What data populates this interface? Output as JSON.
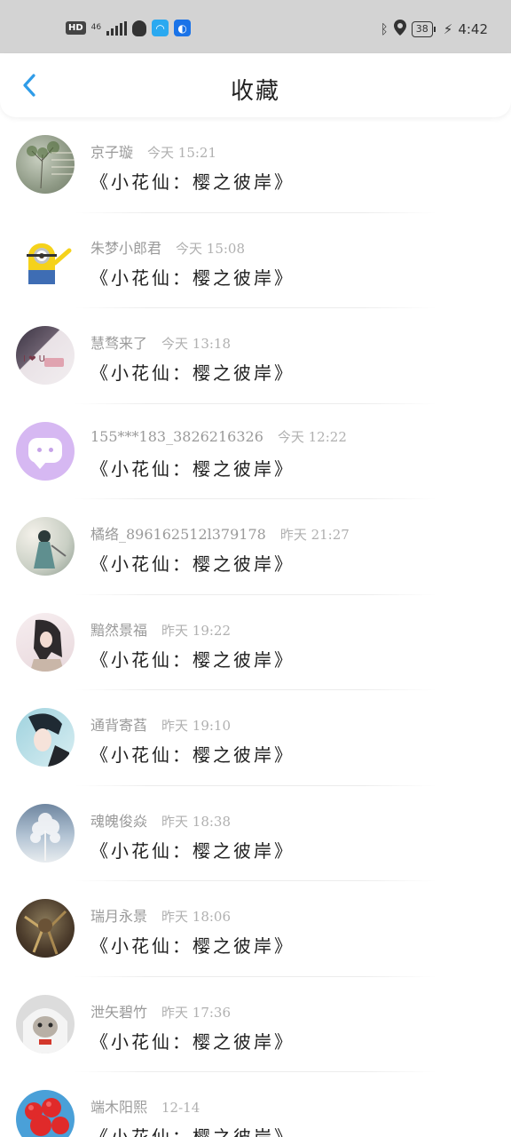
{
  "status_bar": {
    "hd": "HD",
    "network": "46",
    "battery": "38",
    "time": "4:42"
  },
  "header": {
    "title": "收藏"
  },
  "colors": {
    "accent": "#2f9ce8",
    "username": "#9a9a9a",
    "title_text": "#1f1f1f"
  },
  "favorites": [
    {
      "user": "京子璇",
      "time": "今天 15:21",
      "title": "《小花仙：樱之彼岸》",
      "avatar": "a1"
    },
    {
      "user": "朱梦小郎君",
      "time": "今天 15:08",
      "title": "《小花仙：樱之彼岸》",
      "avatar": "a2"
    },
    {
      "user": "慧骛来了",
      "time": "今天 13:18",
      "title": "《小花仙：樱之彼岸》",
      "avatar": "a3"
    },
    {
      "user": "155***183_3826216326",
      "time": "今天 12:22",
      "title": "《小花仙：樱之彼岸》",
      "avatar": "a4"
    },
    {
      "user": "橘络_896162512l379178",
      "time": "昨天 21:27",
      "title": "《小花仙：樱之彼岸》",
      "avatar": "a5"
    },
    {
      "user": "黯然景福",
      "time": "昨天 19:22",
      "title": "《小花仙：樱之彼岸》",
      "avatar": "a6"
    },
    {
      "user": "通背寄萏",
      "time": "昨天 19:10",
      "title": "《小花仙：樱之彼岸》",
      "avatar": "a7"
    },
    {
      "user": "魂魄俊焱",
      "time": "昨天 18:38",
      "title": "《小花仙：樱之彼岸》",
      "avatar": "a8"
    },
    {
      "user": "瑞月永景",
      "time": "昨天 18:06",
      "title": "《小花仙：樱之彼岸》",
      "avatar": "a9"
    },
    {
      "user": "泄矢碧竹",
      "time": "昨天 17:36",
      "title": "《小花仙：樱之彼岸》",
      "avatar": "a10"
    },
    {
      "user": "端木阳熙",
      "time": "12-14",
      "title": "《小花仙：樱之彼岸》",
      "avatar": "a11"
    }
  ]
}
